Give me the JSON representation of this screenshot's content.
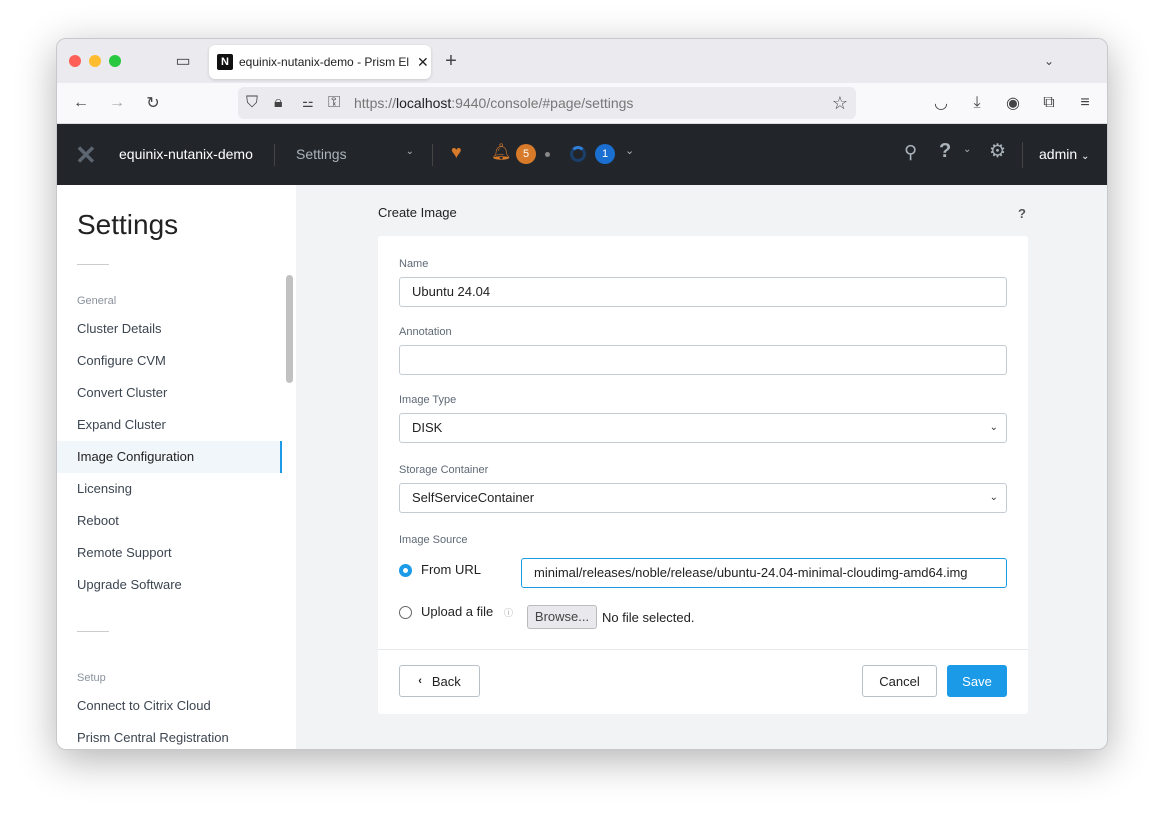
{
  "browser": {
    "tab_title": "equinix-nutanix-demo - Prism El",
    "url_prefix": "https://",
    "url_host": "localhost",
    "url_rest": ":9440/console/#page/settings"
  },
  "header": {
    "cluster": "equinix-nutanix-demo",
    "section": "Settings",
    "alerts_count": "5",
    "tasks_count": "1",
    "user": "admin",
    "colors": {
      "alert": "#d77a2a",
      "task": "#1b6fd0"
    }
  },
  "sidebar": {
    "title": "Settings",
    "sections": [
      {
        "label": "General",
        "items": [
          "Cluster Details",
          "Configure CVM",
          "Convert Cluster",
          "Expand Cluster",
          "Image Configuration",
          "Licensing",
          "Reboot",
          "Remote Support",
          "Upgrade Software"
        ]
      },
      {
        "label": "Setup",
        "items": [
          "Connect to Citrix Cloud",
          "Prism Central Registration"
        ]
      }
    ],
    "active": "Image Configuration"
  },
  "form": {
    "title": "Create Image",
    "help": "?",
    "name_label": "Name",
    "name_value": "Ubuntu 24.04",
    "annotation_label": "Annotation",
    "annotation_value": "",
    "type_label": "Image Type",
    "type_value": "DISK",
    "container_label": "Storage Container",
    "container_value": "SelfServiceContainer",
    "source_label": "Image Source",
    "from_url_label": "From URL",
    "url_value": "minimal/releases/noble/release/ubuntu-24.04-minimal-cloudimg-amd64.img",
    "upload_label": "Upload a file",
    "browse_label": "Browse...",
    "no_file": "No file selected.",
    "back": "Back",
    "cancel": "Cancel",
    "save": "Save",
    "save_color": "#1b9ae8"
  }
}
